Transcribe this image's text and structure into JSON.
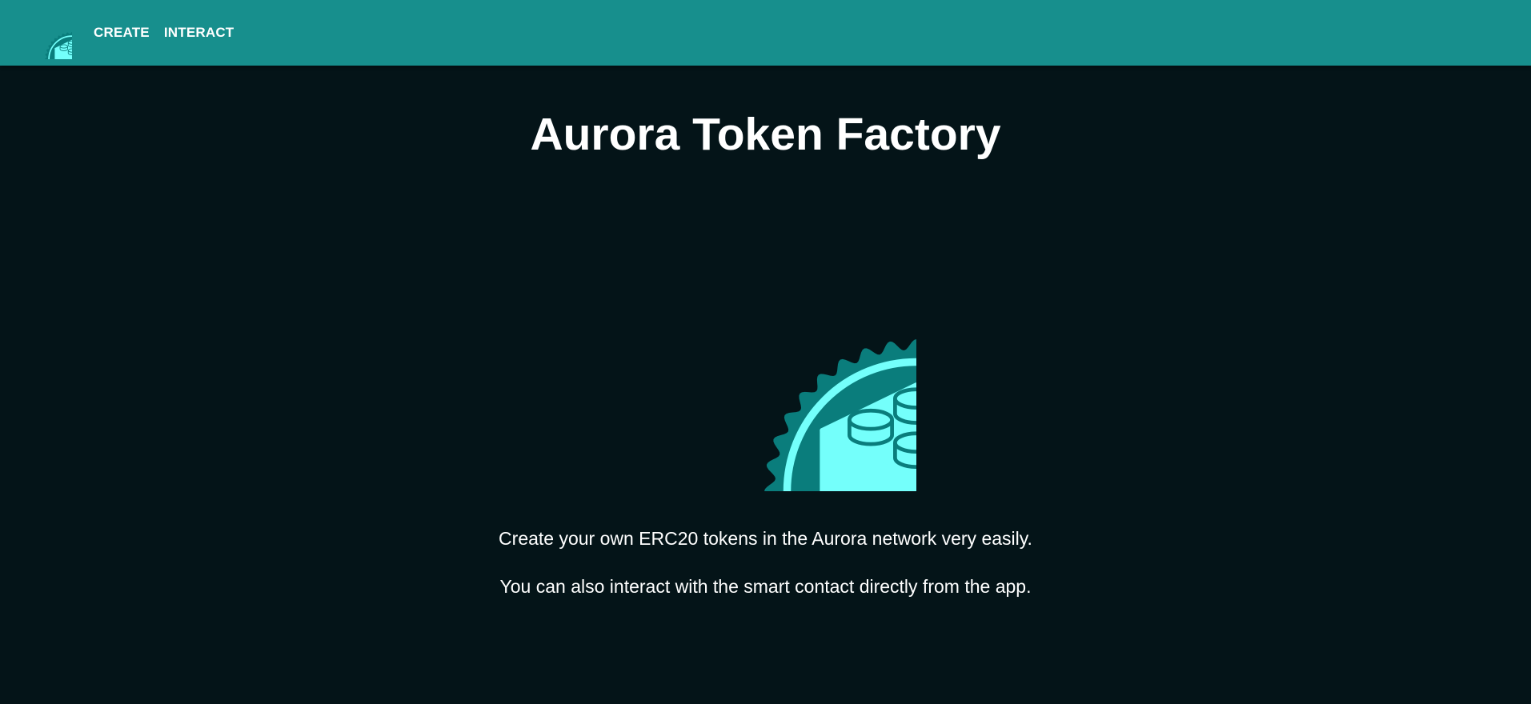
{
  "nav": {
    "logo_icon": "lego-brick-badge-icon",
    "links": [
      {
        "label": "CREATE"
      },
      {
        "label": "INTERACT"
      }
    ]
  },
  "hero": {
    "title": "Aurora Token Factory",
    "logo_icon": "lego-brick-badge-icon",
    "paragraphs": [
      "Create your own ERC20 tokens in the Aurora network very easily.",
      "You can also interact with the smart contact directly from the app."
    ]
  },
  "colors": {
    "navbar": "#178f8d",
    "background": "#041418",
    "badge_dark": "#0a7d7c",
    "badge_light": "#74fffb"
  }
}
